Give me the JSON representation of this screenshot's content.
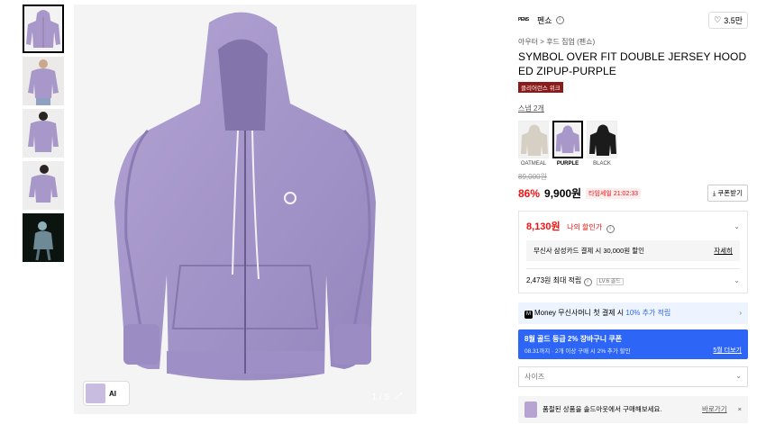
{
  "thumbnails": [
    {
      "name": "thumb-1-hoodie-front",
      "active": true
    },
    {
      "name": "thumb-2-model-front"
    },
    {
      "name": "thumb-3-model-back"
    },
    {
      "name": "thumb-4-model-side"
    },
    {
      "name": "thumb-5-dark-photo"
    }
  ],
  "gallery": {
    "counter": "1 / 5",
    "ai_label": "AI"
  },
  "brand": {
    "logo_text": "PENS",
    "name": "펜쇼",
    "likes": "3.5만"
  },
  "breadcrumb": "아우터 > 후드 집업 (펜쇼)",
  "product": {
    "title": "SYMBOL OVER FIT DOUBLE JERSEY HOODED ZIPUP-PURPLE",
    "tag": "클리어런스 위크",
    "snap": "스냅 2개"
  },
  "colors": [
    {
      "label": "OATMEAL",
      "swatch": "#d6d0c4"
    },
    {
      "label": "PURPLE",
      "swatch": "#a897c9",
      "active": true
    },
    {
      "label": "BLACK",
      "swatch": "#1b1b1b"
    }
  ],
  "price": {
    "original": "89,000원",
    "discount": "86%",
    "current": "9,900원",
    "timer": "타임세일 21:02:33",
    "coupon_button": "쿠폰받기"
  },
  "my_price": {
    "value": "8,130원",
    "label": "나의 할인가",
    "card_promo": "무신사 삼성카드 결제 시 30,000원 할인",
    "card_more": "자세히",
    "points": "2,473원 최대 적립",
    "level": "LV.6 골드"
  },
  "money": {
    "text_a": "Money 무신사머니 첫 결제 시",
    "text_b": "10% 추가 적립"
  },
  "promo": {
    "title": "8월 골드 등급 2% 장바구니 쿠폰",
    "sub": "08.31까지 · 2개 이상 구매 시 2% 추가 할인",
    "more": "5월 더보기"
  },
  "size_select": {
    "placeholder": "사이즈"
  },
  "soldout": {
    "text": "품절된 상품을 솔드아웃에서 구매해보세요.",
    "go": "바로가기",
    "close": "×"
  },
  "colors_theme": {
    "accent_red": "#f31110",
    "accent_blue": "#2d66f6",
    "hoodie": "#a897c9"
  }
}
